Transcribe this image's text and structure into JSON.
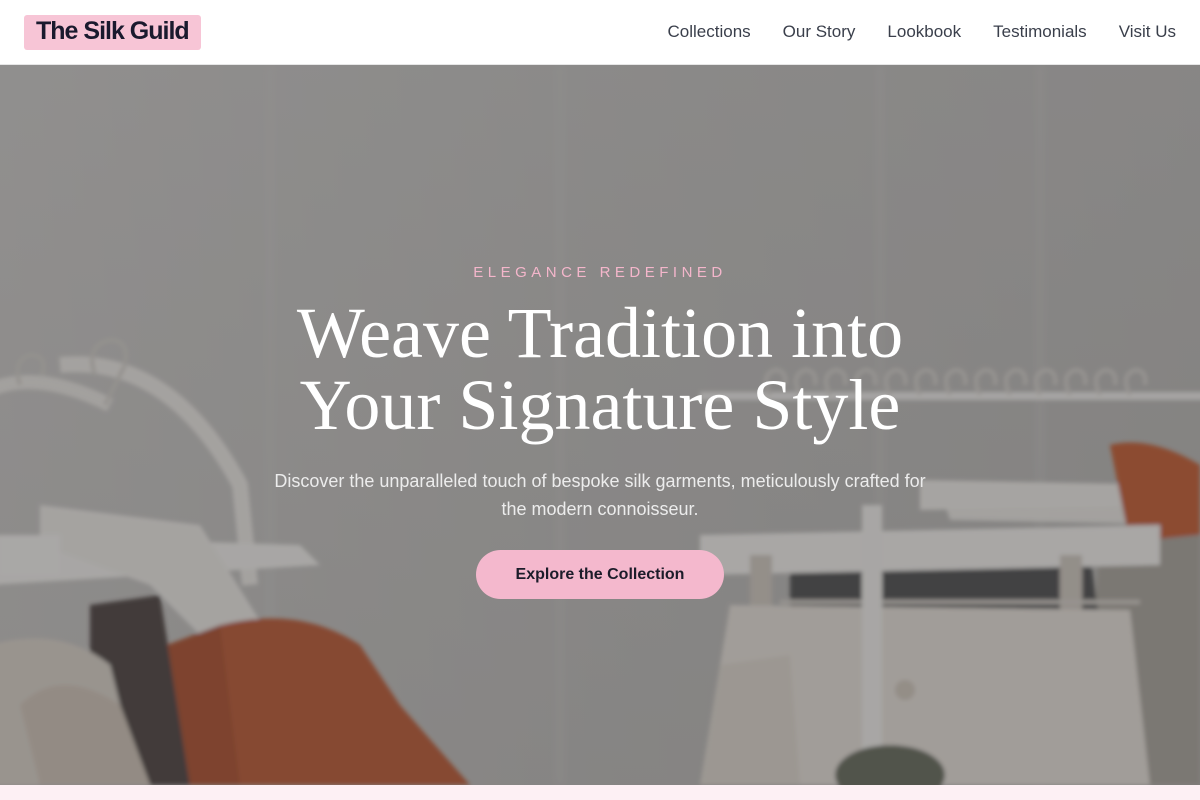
{
  "header": {
    "logo": "The Silk Guild",
    "nav": [
      "Collections",
      "Our Story",
      "Lookbook",
      "Testimonials",
      "Visit Us"
    ]
  },
  "hero": {
    "kicker": "ELEGANCE REDEFINED",
    "headline_line1": "Weave Tradition into",
    "headline_line2": "Your Signature Style",
    "subtext": "Discover the unparalleled touch of bespoke silk garments, meticulously crafted for the modern connoisseur.",
    "cta_label": "Explore the Collection",
    "background": "photo of clothing racks with hangers and garments"
  },
  "colors": {
    "accent_pink": "#f4b8cd",
    "logo_bg": "#f7c5d6",
    "nav_text": "#3a3f4b",
    "kicker": "#f4b6cb"
  }
}
